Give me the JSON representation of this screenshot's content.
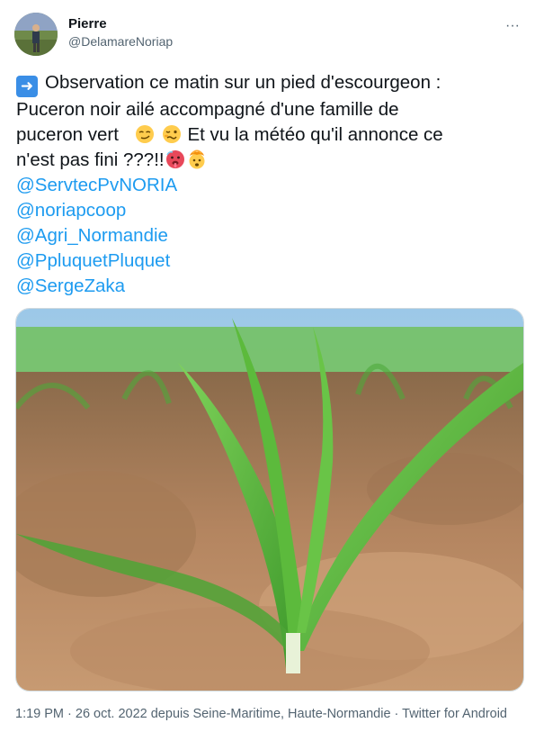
{
  "author": {
    "display_name": "Pierre",
    "handle": "@DelamareNoriap"
  },
  "tweet": {
    "lines": [
      "Observation ce matin sur un pied d'escourgeon :",
      "Puceron noir ailé accompagné d'une famille de",
      "puceron vert",
      "Et vu la météo qu'il annonce ce",
      "n'est pas fini ???!!"
    ],
    "emojis": [
      "arrow-right-emoji",
      "smirk-emoji",
      "woozy-face-emoji",
      "hot-face-emoji",
      "exploding-head-emoji"
    ],
    "mentions": [
      "@ServtecPvNORIA",
      "@noriapcoop",
      "@Agri_Normandie",
      "@PpluquetPluquet",
      "@SergeZaka"
    ]
  },
  "media": {
    "icon": "photo-barley-seedling"
  },
  "meta": {
    "time": "1:19 PM",
    "separator": " · ",
    "date": "26 oct. 2022",
    "location": " depuis Seine-Maritime, Haute-Normandie",
    "source": "Twitter for Android"
  },
  "colors": {
    "link": "#1d9bf0",
    "secondary_text": "#536471",
    "primary_text": "#0f1419"
  }
}
